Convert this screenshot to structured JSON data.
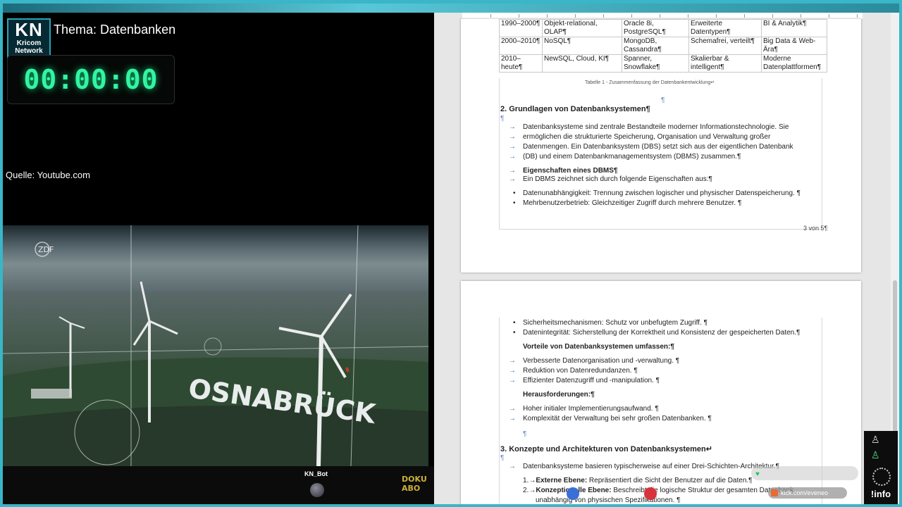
{
  "stream": {
    "logo_big": "KN",
    "logo_line1": "Kricom",
    "logo_line2": "Network",
    "thema": "Thema: Datenbanken",
    "timer": "00:00:00",
    "quelle": "Quelle: Youtube.com",
    "video_brand": "ZDF",
    "video_sign": "OSNABRÜCK",
    "bot_name": "KN_Bot",
    "doku_line1": "DOKU",
    "doku_line2": "ABO"
  },
  "document": {
    "table": [
      [
        "1990–2000¶",
        "Objekt-relational, OLAP¶",
        "Oracle 8i, PostgreSQL¶",
        "Erweiterte Datentypen¶",
        "BI & Analytik¶"
      ],
      [
        "2000–2010¶",
        "NoSQL¶",
        "MongoDB, Cassandra¶",
        "Schemafrei, verteilt¶",
        "Big Data & Web-Ära¶"
      ],
      [
        "2010–heute¶",
        "NewSQL, Cloud, KI¶",
        "Spanner, Snowflake¶",
        "Skalierbar & intelligent¶",
        "Moderne Datenplattformen¶"
      ]
    ],
    "caption": "Tabelle 1 - Zusammenfassung der Datenbankentwicklung↵",
    "section2_title": "2. Grundlagen von Datenbanksystemen¶",
    "section2_para": [
      "Datenbanksysteme sind zentrale Bestandteile moderner Informationstechnologie. Sie",
      "ermöglichen die strukturierte Speicherung, Organisation und Verwaltung großer",
      "Datenmengen. Ein Datenbanksystem (DBS) setzt sich aus der eigentlichen Datenbank",
      "(DB) und einem Datenbankmanagementsystem (DBMS) zusammen.¶"
    ],
    "dbms_heading": "Eigenschaften eines DBMS¶",
    "dbms_intro": "Ein DBMS zeichnet sich durch folgende Eigenschaften aus:¶",
    "dbms_bullets": [
      "Datenunabhängigkeit: Trennung zwischen logischer und physischer Datenspeicherung. ¶",
      "Mehrbenutzerbetrieb: Gleichzeitiger Zugriff durch mehrere Benutzer. ¶"
    ],
    "page_number": "3 von 5¶",
    "p2_bullets": [
      "Sicherheitsmechanismen: Schutz vor unbefugtem Zugriff. ¶",
      "Datenintegrität: Sicherstellung der Korrektheit und Konsistenz der gespeicherten Daten.¶"
    ],
    "vorteile_heading": "Vorteile von Datenbanksystemen umfassen:¶",
    "vorteile": [
      "Verbesserte Datenorganisation und -verwaltung. ¶",
      "Reduktion von Datenredundanzen. ¶",
      "Effizienter Datenzugriff und -manipulation. ¶"
    ],
    "heraus_heading": "Herausforderungen:¶",
    "heraus": [
      "Hoher initialer Implementierungsaufwand. ¶",
      "Komplexität der Verwaltung bei sehr großen Datenbanken. ¶"
    ],
    "section3_title": "3. Konzepte und Architekturen von Datenbanksystemen↵",
    "section3_para": "Datenbanksysteme basieren typischerweise auf einer Drei-Schichten-Architektur.¶",
    "numbered": [
      {
        "num": "1.→",
        "bold": "Externe Ebene:",
        "text": " Repräsentiert die Sicht der Benutzer auf die Daten.¶"
      },
      {
        "num": "2.→",
        "bold": "Konzeptionelle Ebene:",
        "text": " Beschreibt die logische Struktur der gesamten Datenbank,"
      }
    ],
    "numbered_cont": "unabhängig von physischen Spezifikationen. ¶",
    "pilcrow": "¶"
  },
  "overlay": {
    "url": "kick.com/eveneo",
    "info": "!info"
  },
  "colors": {
    "accent": "#39b6c8",
    "timer": "#32f5a1",
    "doku": "#c9b23a"
  }
}
